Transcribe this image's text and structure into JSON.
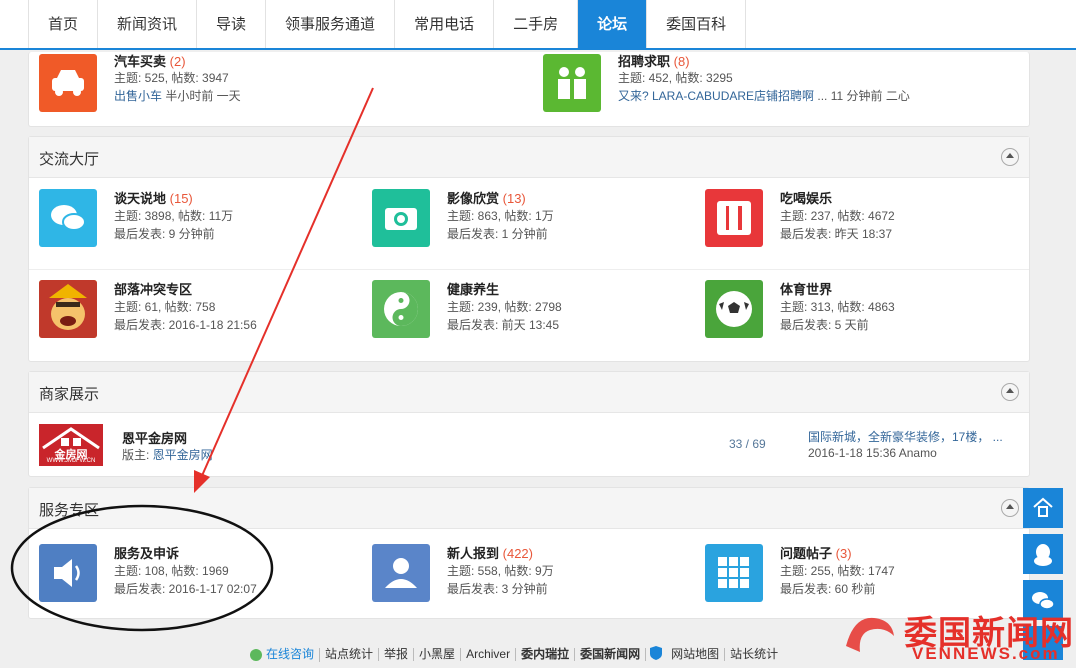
{
  "nav": [
    "首页",
    "新闻资讯",
    "导读",
    "领事服务通道",
    "常用电话",
    "二手房",
    "论坛",
    "委国百科"
  ],
  "top_card": {
    "left": {
      "name": "汽车买卖",
      "count": "(2)",
      "stats": "主题: 525, 帖数: 3947",
      "last_link": "出售小车",
      "last_time": " 半小时前 一天"
    },
    "right": {
      "name": "招聘求职",
      "count": "(8)",
      "stats": "主题: 452, 帖数: 3295",
      "last_link": "又来? LARA-CABUDARE店铺招聘啊",
      "last_time": " ... 11 分钟前 二心"
    }
  },
  "hall": {
    "title": "交流大厅",
    "forums": [
      {
        "name": "谈天说地",
        "count": "(15)",
        "stats": "主题: 3898, 帖数: 11万",
        "last": "最后发表: 9 分钟前"
      },
      {
        "name": "影像欣赏",
        "count": "(13)",
        "stats": "主题: 863, 帖数: 1万",
        "last": "最后发表: 1 分钟前"
      },
      {
        "name": "吃喝娱乐",
        "count": "",
        "stats": "主题: 237, 帖数: 4672",
        "last": "最后发表: 昨天 18:37"
      },
      {
        "name": "部落冲突专区",
        "count": "",
        "stats": "主题: 61, 帖数: 758",
        "last": "最后发表: 2016-1-18 21:56"
      },
      {
        "name": "健康养生",
        "count": "",
        "stats": "主题: 239, 帖数: 2798",
        "last": "最后发表: 前天 13:45"
      },
      {
        "name": "体育世界",
        "count": "",
        "stats": "主题: 313, 帖数: 4863",
        "last": "最后发表: 5 天前"
      }
    ]
  },
  "merchant": {
    "title": "商家展示",
    "logo_text": "金房网",
    "logo_url": "WWW.JMJFW.CN",
    "name": "恩平金房网",
    "moderator_label": "版主: ",
    "moderator": "恩平金房网",
    "ratio": "33 / 69",
    "last_title": "国际新城，全新豪华装修，17楼，  ...",
    "last_time": "2016-1-18 15:36 Anamo"
  },
  "service": {
    "title": "服务专区",
    "forums": [
      {
        "name": "服务及申诉",
        "count": "",
        "stats": "主题: 108, 帖数: 1969",
        "last": "最后发表: 2016-1-17 02:07"
      },
      {
        "name": "新人报到",
        "count": "(422)",
        "stats": "主题: 558, 帖数: 9万",
        "last": "最后发表: 3 分钟前"
      },
      {
        "name": "问题帖子",
        "count": "(3)",
        "stats": "主题: 255, 帖数: 1747",
        "last": "最后发表: 60 秒前"
      }
    ]
  },
  "footer": {
    "consult": "在线咨询",
    "links": [
      "站点统计",
      "举报",
      "小黑屋",
      "Archiver",
      "委内瑞拉",
      "委国新闻网",
      "网站地图",
      "站长统计"
    ]
  },
  "watermark": {
    "cn": "委国新闻网",
    "en": "VENNEWS.com"
  },
  "colors": {
    "accent": "#1a85d8",
    "count": "#e8573a",
    "annotation": "#e5302a"
  }
}
